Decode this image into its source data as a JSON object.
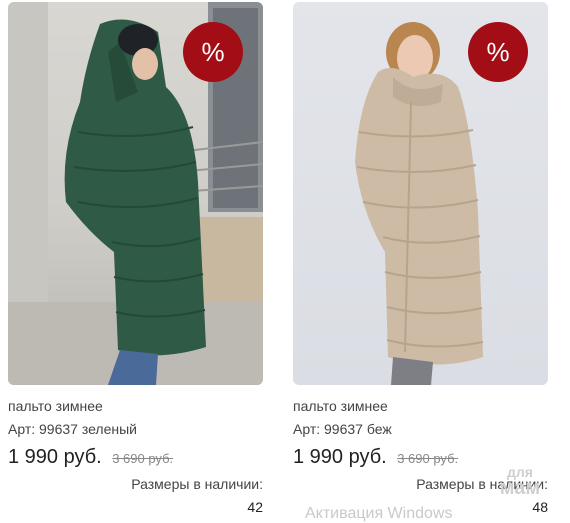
{
  "products": [
    {
      "name": "пальто зимнее",
      "sku": "Арт: 99637 зеленый",
      "price": "1 990 руб.",
      "old_price": "3 690 руб.",
      "sizes_label": "Размеры в наличии:",
      "sizes": "42",
      "badge": "%",
      "coat_color": "#2f5a45"
    },
    {
      "name": "пальто зимнее",
      "sku": "Арт: 99637 беж",
      "price": "1 990 руб.",
      "old_price": "3 690 руб.",
      "sizes_label": "Размеры в наличии:",
      "sizes": "48",
      "badge": "%",
      "coat_color": "#cdbba6"
    }
  ],
  "overlay": {
    "activation_text": "Активация Windows",
    "logo_line1": "для",
    "logo_line2": "мам"
  },
  "colors": {
    "badge": "#a30d15",
    "text": "#444444",
    "old_price": "#888888"
  }
}
